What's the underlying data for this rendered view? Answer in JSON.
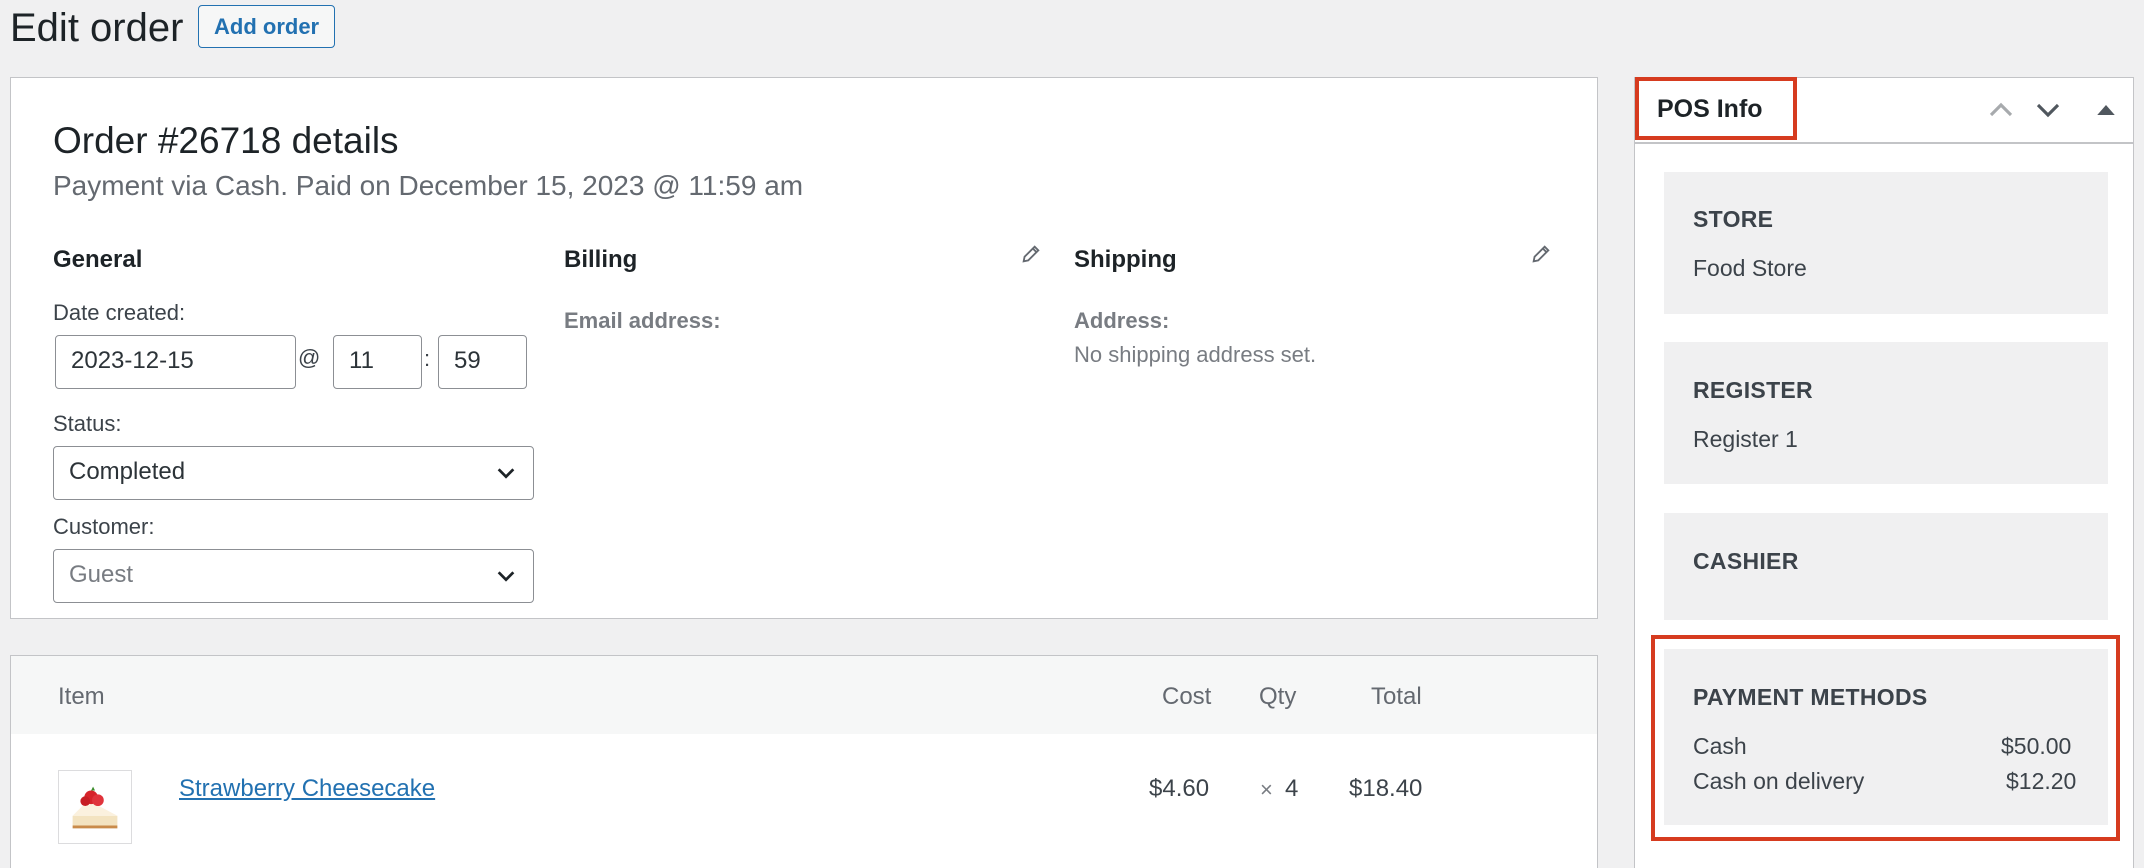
{
  "header": {
    "title": "Edit order",
    "add_order_label": "Add order"
  },
  "order": {
    "heading": "Order #26718 details",
    "payment_info": "Payment via Cash. Paid on December 15, 2023 @ 11:59 am",
    "general": {
      "title": "General",
      "date_label": "Date created:",
      "date_value": "2023-12-15",
      "at": "@",
      "hour_value": "11",
      "colon": ":",
      "minute_value": "59",
      "status_label": "Status:",
      "status_value": "Completed",
      "customer_label": "Customer:",
      "customer_value": "Guest"
    },
    "billing": {
      "title": "Billing",
      "email_label": "Email address:"
    },
    "shipping": {
      "title": "Shipping",
      "address_label": "Address:",
      "address_value": "No shipping address set."
    }
  },
  "items": {
    "columns": {
      "item": "Item",
      "cost": "Cost",
      "qty": "Qty",
      "total": "Total"
    },
    "rows": [
      {
        "name": "Strawberry Cheesecake",
        "cost": "$4.60",
        "qty_x": "×",
        "qty": "4",
        "total": "$18.40"
      }
    ]
  },
  "pos_info": {
    "title": "POS Info",
    "store": {
      "heading": "STORE",
      "value": "Food Store"
    },
    "register": {
      "heading": "REGISTER",
      "value": "Register 1"
    },
    "cashier": {
      "heading": "CASHIER"
    },
    "payment_methods": {
      "heading": "PAYMENT METHODS",
      "rows": [
        {
          "method": "Cash",
          "amount": "$50.00"
        },
        {
          "method": "Cash on delivery",
          "amount": "$12.20"
        }
      ]
    }
  },
  "colors": {
    "accent": "#2271b1",
    "highlight": "#d63b1f"
  }
}
